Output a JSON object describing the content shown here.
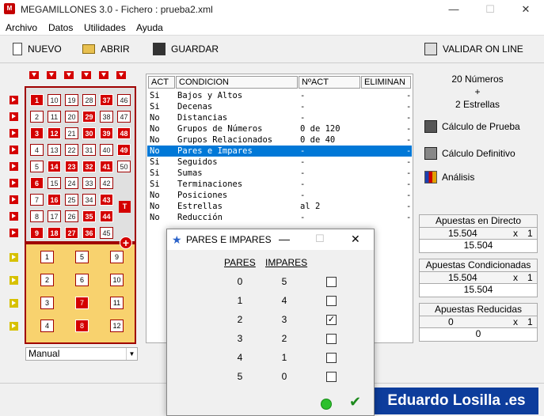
{
  "window": {
    "title": "MEGAMILLONES 3.0 - Fichero : prueba2.xml",
    "icon_label": "M",
    "minimize": "—",
    "maximize": "☐",
    "close": "✕"
  },
  "menu": {
    "items": [
      "Archivo",
      "Datos",
      "Utilidades",
      "Ayuda"
    ]
  },
  "toolbar": {
    "nuevo": "NUEVO",
    "abrir": "ABRIR",
    "guardar": "GUARDAR",
    "validar": "VALIDAR ON LINE"
  },
  "grid": {
    "columns": [
      [
        {
          "n": "1",
          "s": true
        },
        {
          "n": "2",
          "s": false
        },
        {
          "n": "3",
          "s": true
        },
        {
          "n": "4",
          "s": false
        },
        {
          "n": "5",
          "s": false
        },
        {
          "n": "6",
          "s": true
        },
        {
          "n": "7",
          "s": false
        },
        {
          "n": "8",
          "s": false
        },
        {
          "n": "9",
          "s": true
        }
      ],
      [
        {
          "n": "10",
          "s": false
        },
        {
          "n": "11",
          "s": false
        },
        {
          "n": "12",
          "s": true
        },
        {
          "n": "13",
          "s": false
        },
        {
          "n": "14",
          "s": true
        },
        {
          "n": "15",
          "s": false
        },
        {
          "n": "16",
          "s": true
        },
        {
          "n": "17",
          "s": false
        },
        {
          "n": "18",
          "s": true
        }
      ],
      [
        {
          "n": "19",
          "s": false
        },
        {
          "n": "20",
          "s": false
        },
        {
          "n": "21",
          "s": false
        },
        {
          "n": "22",
          "s": false
        },
        {
          "n": "23",
          "s": true
        },
        {
          "n": "24",
          "s": false
        },
        {
          "n": "25",
          "s": false
        },
        {
          "n": "26",
          "s": false
        },
        {
          "n": "27",
          "s": true
        }
      ],
      [
        {
          "n": "28",
          "s": false
        },
        {
          "n": "29",
          "s": true
        },
        {
          "n": "30",
          "s": true
        },
        {
          "n": "31",
          "s": false
        },
        {
          "n": "32",
          "s": true
        },
        {
          "n": "33",
          "s": false
        },
        {
          "n": "34",
          "s": false
        },
        {
          "n": "35",
          "s": true
        },
        {
          "n": "36",
          "s": true
        }
      ],
      [
        {
          "n": "37",
          "s": true
        },
        {
          "n": "38",
          "s": false
        },
        {
          "n": "39",
          "s": true
        },
        {
          "n": "40",
          "s": false
        },
        {
          "n": "41",
          "s": true
        },
        {
          "n": "42",
          "s": false
        },
        {
          "n": "43",
          "s": true
        },
        {
          "n": "44",
          "s": true
        },
        {
          "n": "45",
          "s": false
        }
      ],
      [
        {
          "n": "46",
          "s": false
        },
        {
          "n": "47",
          "s": false
        },
        {
          "n": "48",
          "s": true
        },
        {
          "n": "49",
          "s": true
        },
        {
          "n": "50",
          "s": false
        }
      ]
    ],
    "stars": [
      [
        {
          "n": "1",
          "s": false
        },
        {
          "n": "2",
          "s": false
        },
        {
          "n": "3",
          "s": false
        },
        {
          "n": "4",
          "s": false
        }
      ],
      [
        {
          "n": "5",
          "s": false
        },
        {
          "n": "6",
          "s": false
        },
        {
          "n": "7",
          "s": true
        },
        {
          "n": "8",
          "s": true
        }
      ],
      [
        {
          "n": "9",
          "s": false
        },
        {
          "n": "10",
          "s": false
        },
        {
          "n": "11",
          "s": false
        },
        {
          "n": "12",
          "s": false
        }
      ]
    ],
    "t_badge": "T",
    "plus_badge": "+",
    "mode": "Manual"
  },
  "table": {
    "headers": [
      "ACT",
      "CONDICION",
      "NºACT",
      "ELIMINAN"
    ],
    "rows": [
      {
        "act": "Si",
        "cond": "Bajos y Altos",
        "nact": "-",
        "elim": "-"
      },
      {
        "act": "Si",
        "cond": "Decenas",
        "nact": "-",
        "elim": "-"
      },
      {
        "act": "No",
        "cond": "Distancias",
        "nact": "-",
        "elim": "-"
      },
      {
        "act": "No",
        "cond": "Grupos de Números",
        "nact": "0 de 120",
        "elim": "-"
      },
      {
        "act": "No",
        "cond": "Grupos Relacionados",
        "nact": "0 de 40",
        "elim": "-"
      },
      {
        "act": "No",
        "cond": "Pares e Impares",
        "nact": "-",
        "elim": "-"
      },
      {
        "act": "Si",
        "cond": "Seguidos",
        "nact": "-",
        "elim": "-"
      },
      {
        "act": "Si",
        "cond": "Sumas",
        "nact": "-",
        "elim": "-"
      },
      {
        "act": "Si",
        "cond": "Terminaciones",
        "nact": "-",
        "elim": "-"
      },
      {
        "act": "No",
        "cond": "Posiciones",
        "nact": "-",
        "elim": "-"
      },
      {
        "act": "No",
        "cond": "Estrellas",
        "nact": "al 2",
        "elim": "-"
      },
      {
        "act": "No",
        "cond": "Reducción",
        "nact": "-",
        "elim": "-"
      }
    ],
    "selected_index": 5
  },
  "summary": {
    "line1": "20 Números",
    "line2": "+",
    "line3": "2 Estrellas"
  },
  "actions": {
    "prueba": "Cálculo de Prueba",
    "definitivo": "Cálculo Definitivo",
    "analisis": "Análisis"
  },
  "boxes": [
    {
      "title": "Apuestas en Directo",
      "value": "15.504",
      "mult": "x",
      "factor": "1",
      "result": "15.504"
    },
    {
      "title": "Apuestas Condicionadas",
      "value": "15.504",
      "mult": "x",
      "factor": "1",
      "result": "15.504"
    },
    {
      "title": "Apuestas Reducidas",
      "value": "0",
      "mult": "x",
      "factor": "1",
      "result": "0"
    }
  ],
  "dialog": {
    "title": "PARES E IMPARES",
    "col_pares": "PARES",
    "col_impares": "IMPARES",
    "rows": [
      {
        "p": "0",
        "i": "5",
        "c": false
      },
      {
        "p": "1",
        "i": "4",
        "c": false
      },
      {
        "p": "2",
        "i": "3",
        "c": true
      },
      {
        "p": "3",
        "i": "2",
        "c": false
      },
      {
        "p": "4",
        "i": "1",
        "c": false
      },
      {
        "p": "5",
        "i": "0",
        "c": false
      }
    ],
    "accept": "✔"
  },
  "brand": "Eduardo Losilla .es"
}
